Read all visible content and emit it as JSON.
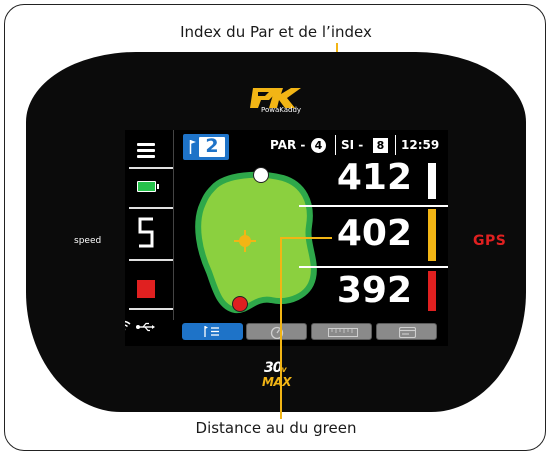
{
  "annotations": {
    "top": "Index du Par et de l’index",
    "bottom": "Distance au du green"
  },
  "brand": {
    "logo_text": "PowaKaddy",
    "model_line1": "30",
    "model_sup": "v",
    "model_line2": "MAX"
  },
  "side_label": {
    "speed": "speed",
    "gps": "GPS"
  },
  "header": {
    "hole_number": "2",
    "par_label": "PAR -",
    "par_value": "4",
    "si_label": "SI -",
    "si_value": "8",
    "time": "12:59"
  },
  "sidebar": {
    "speed_digit": "5"
  },
  "distances": [
    {
      "value": "412",
      "position": "back",
      "marker_color": "#ffffff"
    },
    {
      "value": "402",
      "position": "center",
      "marker_color": "#f2b515"
    },
    {
      "value": "392",
      "position": "front",
      "marker_color": "#e02020"
    }
  ],
  "colors": {
    "accent_blue": "#1e73c8",
    "green_fill": "#8bd03f",
    "green_edge": "#2ea84a",
    "gps_red": "#e02020",
    "battery": "#27c24c"
  },
  "tabs": [
    {
      "icon": "flag-list-icon",
      "active": true
    },
    {
      "icon": "gauge-icon",
      "active": false
    },
    {
      "icon": "ruler-icon",
      "active": false
    },
    {
      "icon": "card-icon",
      "active": false
    }
  ]
}
